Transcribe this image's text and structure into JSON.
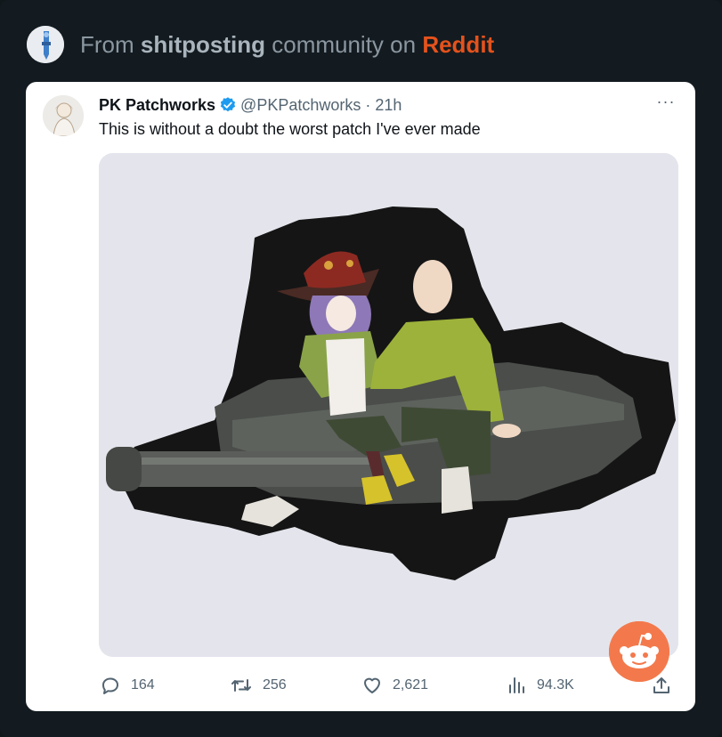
{
  "header": {
    "prefix": "From",
    "community": "shitposting",
    "middle": "community on",
    "platform": "Reddit"
  },
  "tweet": {
    "author_name": "PK Patchworks",
    "handle": "@PKPatchworks",
    "separator": "·",
    "time": "21h",
    "more": "···",
    "text": "This is without a doubt the worst patch I've ever made",
    "stats": {
      "replies": "164",
      "retweets": "256",
      "likes": "2,621",
      "views": "94.3K"
    }
  },
  "colors": {
    "reddit_orange": "#e4521c",
    "verified_blue": "#1d9bf0",
    "background": "#131b20"
  }
}
